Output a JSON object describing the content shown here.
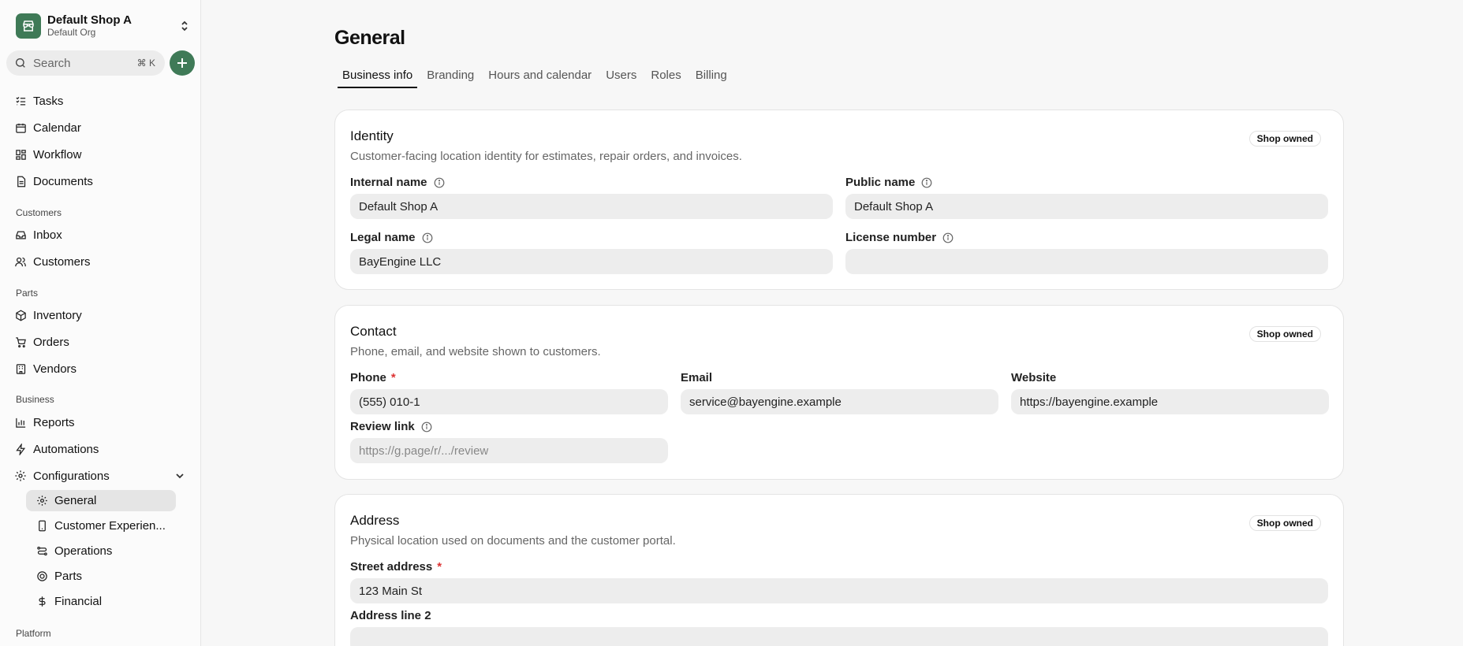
{
  "sidebar": {
    "shop_name": "Default Shop A",
    "org_name": "Default Org",
    "search_placeholder": "Search",
    "search_shortcut": "⌘ K",
    "nav": [
      {
        "label": "Tasks",
        "icon": "tasks-icon"
      },
      {
        "label": "Calendar",
        "icon": "calendar-icon"
      },
      {
        "label": "Workflow",
        "icon": "workflow-icon"
      },
      {
        "label": "Documents",
        "icon": "documents-icon"
      }
    ],
    "sections": {
      "customers": "Customers",
      "parts": "Parts",
      "business": "Business",
      "platform": "Platform"
    },
    "customers_items": [
      {
        "label": "Inbox",
        "icon": "inbox-icon"
      },
      {
        "label": "Customers",
        "icon": "users-icon"
      }
    ],
    "parts_items": [
      {
        "label": "Inventory",
        "icon": "box-icon"
      },
      {
        "label": "Orders",
        "icon": "cart-icon"
      },
      {
        "label": "Vendors",
        "icon": "vendors-icon"
      }
    ],
    "business_items": [
      {
        "label": "Reports",
        "icon": "chart-icon"
      },
      {
        "label": "Automations",
        "icon": "bolt-icon"
      },
      {
        "label": "Configurations",
        "icon": "gear-icon"
      }
    ],
    "config_items": [
      {
        "label": "General",
        "icon": "gear-icon",
        "active": true
      },
      {
        "label": "Customer Experien...",
        "icon": "phone-icon"
      },
      {
        "label": "Operations",
        "icon": "operations-icon"
      },
      {
        "label": "Parts",
        "icon": "parts-icon"
      },
      {
        "label": "Financial",
        "icon": "dollar-icon"
      }
    ]
  },
  "page": {
    "title": "General",
    "tabs": [
      "Business info",
      "Branding",
      "Hours and calendar",
      "Users",
      "Roles",
      "Billing"
    ],
    "active_tab": "Business info"
  },
  "identity": {
    "title": "Identity",
    "description": "Customer-facing location identity for estimates, repair orders, and invoices.",
    "badge": "Shop owned",
    "internal_name_label": "Internal name",
    "internal_name_value": "Default Shop A",
    "public_name_label": "Public name",
    "public_name_value": "Default Shop A",
    "legal_name_label": "Legal name",
    "legal_name_value": "BayEngine LLC",
    "license_number_label": "License number",
    "license_number_value": ""
  },
  "contact": {
    "title": "Contact",
    "description": "Phone, email, and website shown to customers.",
    "badge": "Shop owned",
    "phone_label": "Phone",
    "required_mark": "*",
    "phone_value": "(555) 010-1",
    "email_label": "Email",
    "email_value": "service@bayengine.example",
    "website_label": "Website",
    "website_value": "https://bayengine.example",
    "review_link_label": "Review link",
    "review_link_placeholder": "https://g.page/r/.../review"
  },
  "address": {
    "title": "Address",
    "description": "Physical location used on documents and the customer portal.",
    "badge": "Shop owned",
    "street_label": "Street address",
    "required_mark": "*",
    "street_value": "123 Main St",
    "line2_label": "Address line 2",
    "line2_value": ""
  },
  "colors": {
    "accent": "#3f7a57",
    "required": "#dd3333"
  }
}
